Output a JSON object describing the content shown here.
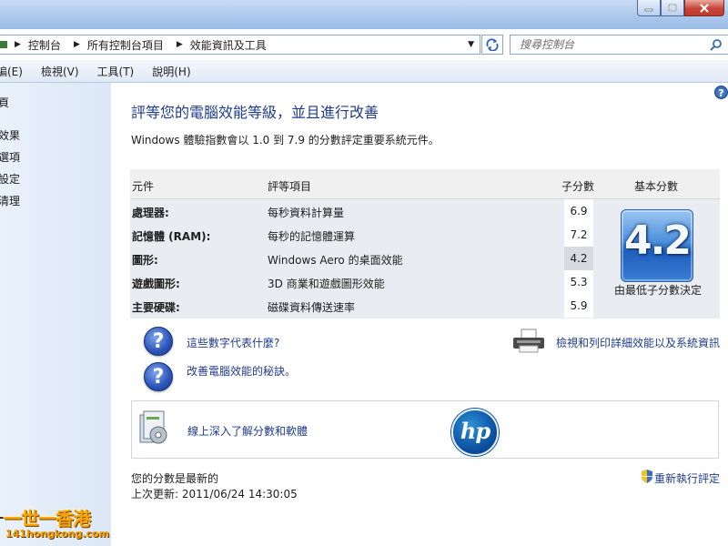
{
  "address": {
    "crumbs": [
      {
        "label": "控制台"
      },
      {
        "label": "所有控制台項目"
      },
      {
        "label": "效能資訊及工具"
      }
    ]
  },
  "search": {
    "placeholder": "搜尋控制台"
  },
  "menu": {
    "items": [
      "編(E)",
      "檢視(V)",
      "工具(T)",
      "說明(H)"
    ]
  },
  "sidebar": {
    "items": [
      "頁",
      "效果",
      "選項",
      "設定",
      "清理"
    ]
  },
  "main": {
    "title": "評等您的電腦效能等級，並且進行改善",
    "intro": "Windows 體驗指數會以 1.0 到 7.9 的分數評定重要系統元件。",
    "table": {
      "headers": {
        "component": "元件",
        "item": "評等項目",
        "subscore": "子分數",
        "basescore": "基本分數"
      },
      "rows": [
        {
          "component": "處理器:",
          "description": "每秒資料計算量",
          "subscore": "6.9"
        },
        {
          "component": "記憶體 (RAM):",
          "description": "每秒的記憶體運算",
          "subscore": "7.2"
        },
        {
          "component": "圖形:",
          "description": "Windows Aero 的桌面效能",
          "subscore": "4.2"
        },
        {
          "component": "遊戲圖形:",
          "description": "3D 商業和遊戲圖形效能",
          "subscore": "5.3"
        },
        {
          "component": "主要硬碟:",
          "description": "磁碟資料傳送速率",
          "subscore": "5.9"
        }
      ],
      "base_score": "4.2",
      "base_caption": "由最低子分數決定"
    },
    "links": {
      "what_mean": "這些數字代表什麼?",
      "tips": "改善電腦效能的秘訣。",
      "print": "檢視和列印詳細效能以及系統資訊"
    },
    "software_link": "線上深入了解分數和軟體",
    "hp_logo_text": "hp",
    "status_current": "您的分數是最新的",
    "last_update": "上次更新: 2011/06/24 14:30:05",
    "rerun": "重新執行評定"
  },
  "watermark": {
    "title": "一世一香港",
    "url": "141hongkong.com"
  },
  "colors": {
    "link": "#1e3c8c",
    "score_tile": "#2f6fcc",
    "lowest_subscore_bg": "#d7dbe1"
  }
}
